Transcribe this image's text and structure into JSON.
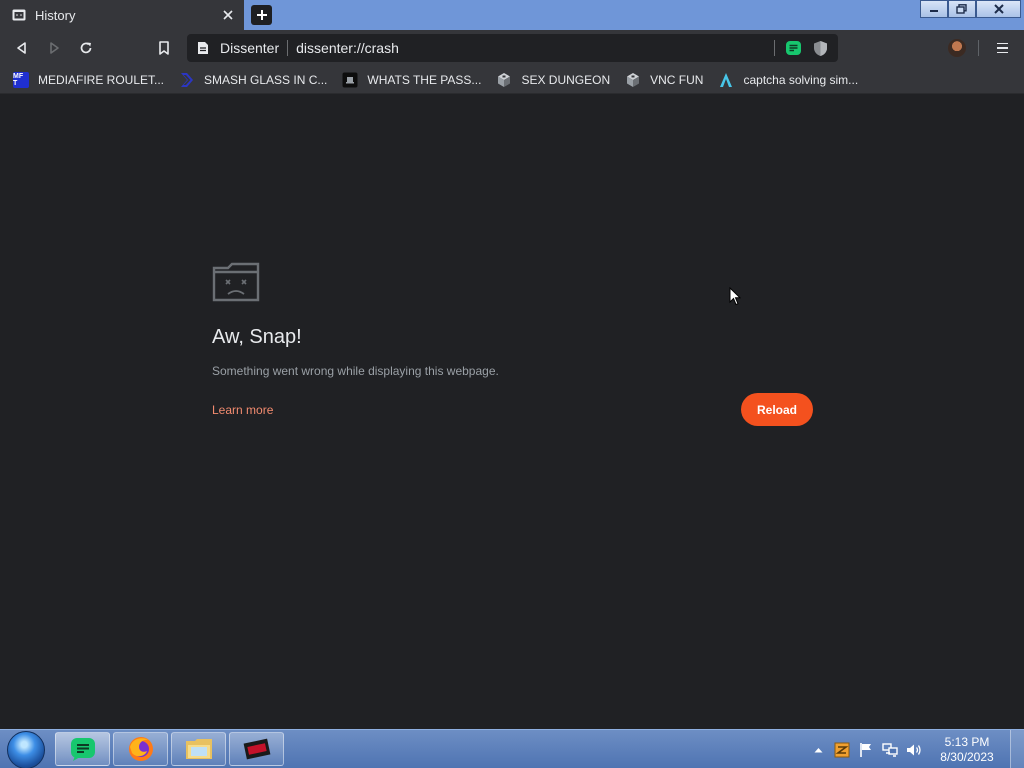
{
  "browser": {
    "tab": {
      "title": "History",
      "favicon": "history-icon"
    },
    "window_controls": [
      "minimize-icon",
      "restore-icon",
      "close-icon"
    ],
    "toolbar": {
      "site_name": "Dissenter",
      "url": "dissenter://crash"
    },
    "bookmarks": [
      {
        "label": "MEDIAFIRE ROULET...",
        "icon": "mediafire-icon",
        "icon_text": "MF T"
      },
      {
        "label": "SMASH GLASS IN C...",
        "icon": "chevron-icon"
      },
      {
        "label": "WHATS THE PASS...",
        "icon": "dark-square-icon"
      },
      {
        "label": "SEX DUNGEON",
        "icon": "globe-icon"
      },
      {
        "label": "VNC FUN",
        "icon": "globe-icon"
      },
      {
        "label": "captcha solving sim...",
        "icon": "lambda-icon"
      }
    ]
  },
  "error_page": {
    "title": "Aw, Snap!",
    "message": "Something went wrong while displaying this webpage.",
    "learn_more": "Learn more",
    "reload": "Reload"
  },
  "taskbar": {
    "apps": [
      "dissenter-icon",
      "firefox-icon",
      "file-explorer-icon",
      "media-app-icon"
    ],
    "tray_icons": [
      "show-hidden-icons",
      "tray-app-icon",
      "flag-icon",
      "network-icon",
      "volume-icon"
    ],
    "time": "5:13 PM",
    "date": "8/30/2023"
  },
  "colors": {
    "accent": "#f4511e",
    "link": "#f28b6f",
    "page_bg": "#202124",
    "toolbar_bg": "#35363a",
    "titlebar_bg": "#6f96d8",
    "dissenter_green": "#17c76e"
  }
}
